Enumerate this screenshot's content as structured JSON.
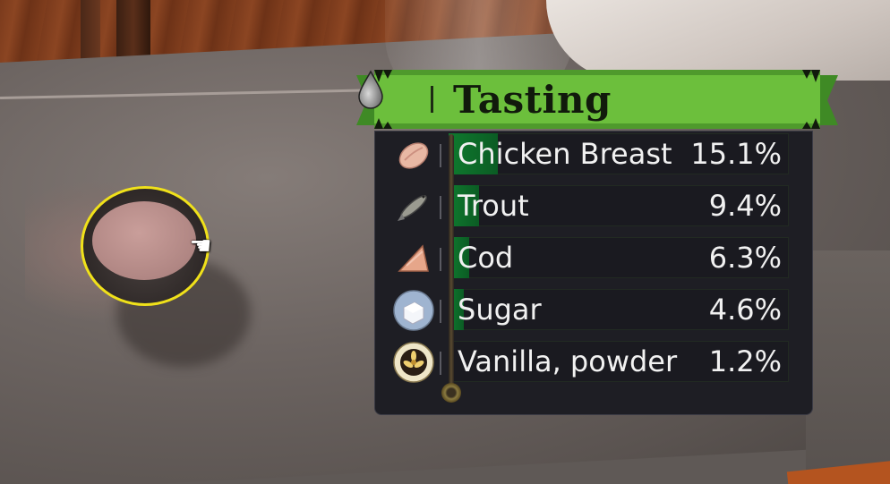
{
  "panel": {
    "title": "Tasting",
    "icon": "water-drop-icon",
    "accent_color": "#6cbf3c",
    "bar_color": "#0f7a2e"
  },
  "ingredients": [
    {
      "name": "Chicken Breast",
      "percent_label": "15.1%",
      "percent": 15.1,
      "icon": "chicken-breast-icon"
    },
    {
      "name": "Trout",
      "percent_label": "9.4%",
      "percent": 9.4,
      "icon": "trout-icon"
    },
    {
      "name": "Cod",
      "percent_label": "6.3%",
      "percent": 6.3,
      "icon": "cod-icon"
    },
    {
      "name": "Sugar",
      "percent_label": "4.6%",
      "percent": 4.6,
      "icon": "sugar-icon"
    },
    {
      "name": "Vanilla, powder",
      "percent_label": "1.2%",
      "percent": 1.2,
      "icon": "vanilla-icon"
    }
  ],
  "scene": {
    "selected_object": "bowl",
    "highlight_color": "#f0e11a",
    "cursor": "hand-cursor-icon"
  }
}
